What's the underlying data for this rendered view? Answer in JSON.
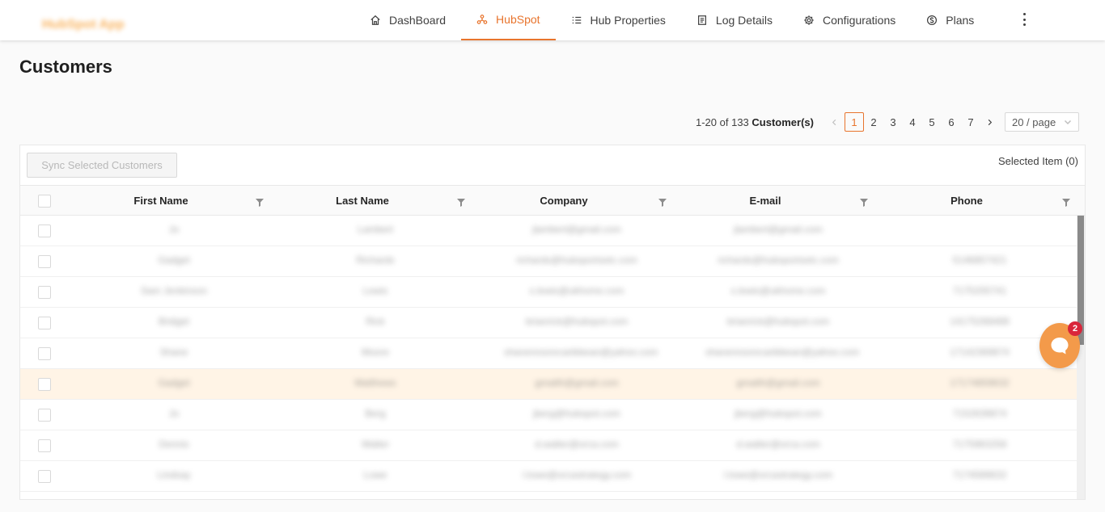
{
  "app": {
    "logo_text": "HubSpot App"
  },
  "nav": {
    "items": [
      {
        "label": "DashBoard",
        "icon": "home-icon",
        "active": false
      },
      {
        "label": "HubSpot",
        "icon": "hubspot-icon",
        "active": true
      },
      {
        "label": "Hub Properties",
        "icon": "list-icon",
        "active": false
      },
      {
        "label": "Log Details",
        "icon": "document-icon",
        "active": false
      },
      {
        "label": "Configurations",
        "icon": "gear-icon",
        "active": false
      },
      {
        "label": "Plans",
        "icon": "dollar-circle-icon",
        "active": false
      }
    ],
    "more_icon": "more-vertical-icon"
  },
  "page": {
    "title": "Customers"
  },
  "pagination": {
    "range_text": "1-20 of 133",
    "entity_label": "Customer(s)",
    "pages": [
      "1",
      "2",
      "3",
      "4",
      "5",
      "6",
      "7"
    ],
    "current_page": "1",
    "page_size_label": "20 / page"
  },
  "toolbar": {
    "sync_button_label": "Sync Selected Customers",
    "selected_label": "Selected Item (0)"
  },
  "table": {
    "columns": [
      "First Name",
      "Last Name",
      "Company",
      "E-mail",
      "Phone"
    ],
    "rows": [
      {
        "first": "Jo",
        "last": "Lambert",
        "company": "jlambert@gmail.com",
        "email": "jlambert@gmail.com",
        "phone": ""
      },
      {
        "first": "Gadget",
        "last": "Richards",
        "company": "richards@hubsportsetc.com",
        "email": "richards@hubsportsetc.com",
        "phone": "5146857421"
      },
      {
        "first": "Sam Jenkinson",
        "last": "Lewis",
        "company": "s.lewis@ukhome.com",
        "email": "s.lewis@ukhome.com",
        "phone": "7175205741"
      },
      {
        "first": "Bridget",
        "last": "Rick",
        "company": "brianrick@hubspot.com",
        "email": "brianrick@hubspot.com",
        "phone": "14175268489"
      },
      {
        "first": "Shane",
        "last": "Moore",
        "company": "shanemoorecaribbean@yahoo.com",
        "email": "shanemoorecaribbean@yahoo.com",
        "phone": "17142369874"
      },
      {
        "first": "Gadget",
        "last": "Matthews",
        "company": "gmatth@gmail.com",
        "email": "gmatth@gmail.com",
        "phone": "17174859632"
      },
      {
        "first": "Jo",
        "last": "Berg",
        "company": "jberg@hubspot.com",
        "email": "jberg@hubspot.com",
        "phone": "7152639874"
      },
      {
        "first": "Dennis",
        "last": "Walter",
        "company": "d.walter@orca.com",
        "email": "d.walter@orca.com",
        "phone": "7175963258"
      },
      {
        "first": "Lindsay",
        "last": "Lowe",
        "company": "l.lowe@orcastrategy.com",
        "email": "l.lowe@orcastrategy.com",
        "phone": "7174589632"
      }
    ]
  },
  "chat": {
    "badge_count": "2",
    "icon": "chat-icon"
  },
  "colors": {
    "accent": "#e8742d",
    "chat": "#f39a4a",
    "badge": "#d9263b",
    "highlight_row": "#fff4e6"
  }
}
